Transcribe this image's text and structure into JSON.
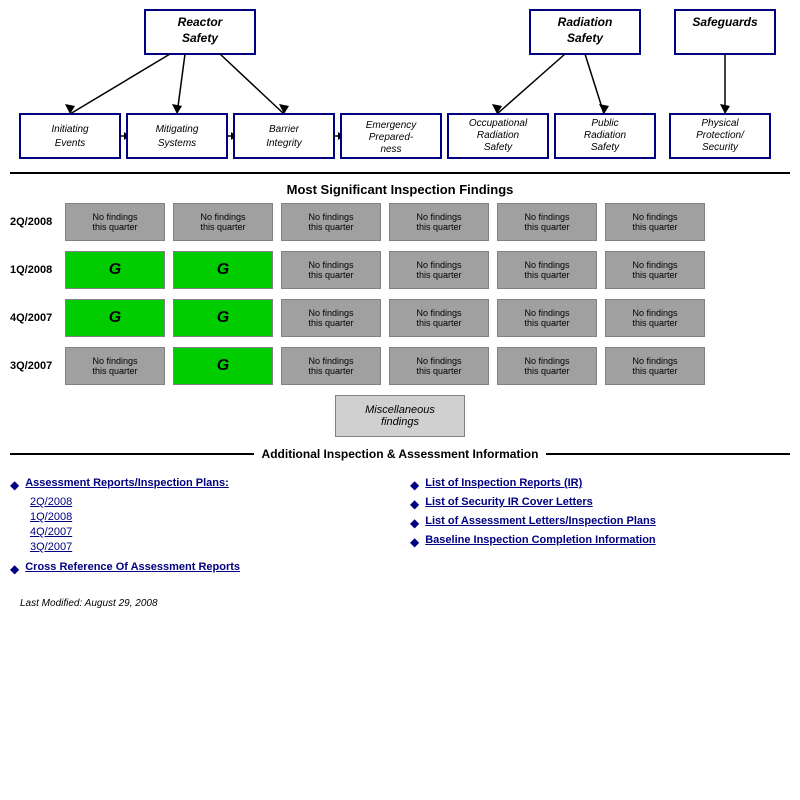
{
  "diagram": {
    "reactorSafety": {
      "label": "Reactor\nSafety"
    },
    "radiationSafety": {
      "label": "Radiation\nSafety"
    },
    "safeguards": {
      "label": "Safeguards"
    },
    "flowBoxes": [
      {
        "id": "initiating",
        "label": "Initiating\nEvents"
      },
      {
        "id": "mitigating",
        "label": "Mitigating\nSystems"
      },
      {
        "id": "barrier",
        "label": "Barrier\nIntegrity"
      },
      {
        "id": "emergency",
        "label": "Emergency\nPreparedness"
      },
      {
        "id": "occupational",
        "label": "Occupational\nRadiation\nSafety"
      },
      {
        "id": "public",
        "label": "Public\nRadiation\nSafety"
      },
      {
        "id": "physical",
        "label": "Physical\nProtection/\nSecurity"
      }
    ]
  },
  "sections": {
    "mostSignificant": "Most Significant Inspection Findings",
    "additional": "Additional Inspection & Assessment Information"
  },
  "quarters": [
    {
      "label": "2Q/2008",
      "cells": [
        {
          "type": "gray",
          "text": "No findings\nthis quarter"
        },
        {
          "type": "gray",
          "text": "No findings\nthis quarter"
        },
        {
          "type": "gray",
          "text": "No findings\nthis quarter"
        },
        {
          "type": "gray",
          "text": "No findings\nthis quarter"
        },
        {
          "type": "gray",
          "text": "No findings\nthis quarter"
        },
        {
          "type": "gray",
          "text": "No findings\nthis quarter"
        }
      ]
    },
    {
      "label": "1Q/2008",
      "cells": [
        {
          "type": "green",
          "text": "G"
        },
        {
          "type": "green",
          "text": "G"
        },
        {
          "type": "gray",
          "text": "No findings\nthis quarter"
        },
        {
          "type": "gray",
          "text": "No findings\nthis quarter"
        },
        {
          "type": "gray",
          "text": "No findings\nthis quarter"
        },
        {
          "type": "gray",
          "text": "No findings\nthis quarter"
        }
      ]
    },
    {
      "label": "4Q/2007",
      "cells": [
        {
          "type": "green",
          "text": "G"
        },
        {
          "type": "green",
          "text": "G"
        },
        {
          "type": "gray",
          "text": "No findings\nthis quarter"
        },
        {
          "type": "gray",
          "text": "No findings\nthis quarter"
        },
        {
          "type": "gray",
          "text": "No findings\nthis quarter"
        },
        {
          "type": "gray",
          "text": "No findings\nthis quarter"
        }
      ]
    },
    {
      "label": "3Q/2007",
      "cells": [
        {
          "type": "gray",
          "text": "No findings\nthis quarter"
        },
        {
          "type": "green",
          "text": "G"
        },
        {
          "type": "gray",
          "text": "No findings\nthis quarter"
        },
        {
          "type": "gray",
          "text": "No findings\nthis quarter"
        },
        {
          "type": "gray",
          "text": "No findings\nthis quarter"
        },
        {
          "type": "gray",
          "text": "No findings\nthis quarter"
        }
      ]
    }
  ],
  "miscFindings": {
    "label": "Miscellaneous\nfindings"
  },
  "leftLinks": {
    "header": "Assessment Reports/Inspection Plans:",
    "items": [
      "2Q/2008",
      "1Q/2008",
      "4Q/2007",
      "3Q/2007"
    ],
    "footer": "Cross Reference Of Assessment Reports"
  },
  "rightLinks": {
    "items": [
      "List of Inspection Reports (IR)",
      "List of Security IR Cover Letters",
      "List of Assessment Letters/Inspection Plans",
      "Baseline Inspection Completion Information"
    ]
  },
  "lastModified": "Last Modified:  August 29, 2008"
}
